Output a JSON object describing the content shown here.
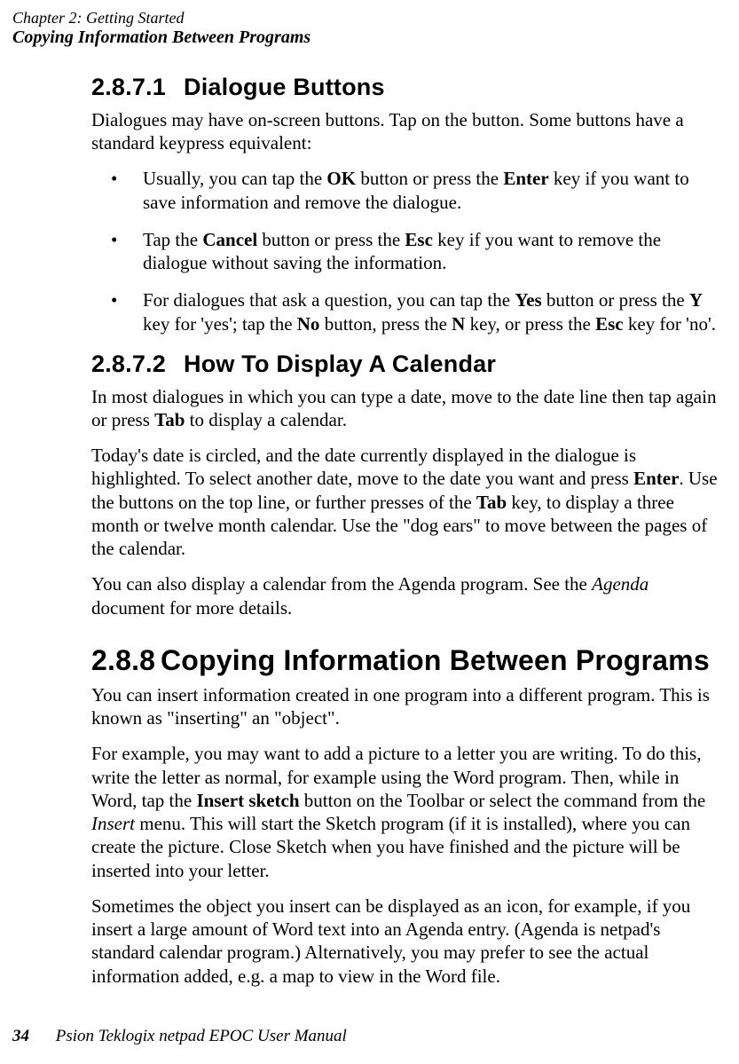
{
  "header": {
    "chapter": "Chapter 2:  Getting Started",
    "section": "Copying Information Between Programs"
  },
  "s1": {
    "num": "2.8.7.1",
    "title": "Dialogue Buttons",
    "intro_a": "Dialogues may have on-screen buttons. Tap on the button. Some buttons have a standard keypress equivalent:",
    "b1_a": "Usually, you can tap the ",
    "b1_ok": "OK",
    "b1_b": " button or press the ",
    "b1_enter": "Enter",
    "b1_c": " key if you want to save information and remove the dialogue.",
    "b2_a": "Tap the ",
    "b2_cancel": "Cancel",
    "b2_b": " button or press the ",
    "b2_esc": "Esc",
    "b2_c": " key if you want to remove the dialogue without saving the information.",
    "b3_a": "For dialogues that ask a question, you can tap the ",
    "b3_yes": "Yes",
    "b3_b": " button or press the ",
    "b3_Y": "Y",
    "b3_c": " key for 'yes'; tap the ",
    "b3_no": "No",
    "b3_d": " button, press the ",
    "b3_N": "N",
    "b3_e": " key, or press the ",
    "b3_esc": "Esc",
    "b3_f": " key for 'no'."
  },
  "s2": {
    "num": "2.8.7.2",
    "title": "How To Display A Calendar",
    "p1_a": "In most dialogues in which you can type a date, move to the date line then tap again or press ",
    "p1_tab": "Tab",
    "p1_b": " to display a calendar.",
    "p2_a": "Today's date is circled, and the date currently displayed in the dialogue is highlighted. To select another date, move to the date you want and press ",
    "p2_enter": "Enter",
    "p2_b": ". Use the buttons on the top line, or further presses of the ",
    "p2_tab": "Tab",
    "p2_c": " key, to display a three month or twelve month calendar. Use the \"dog ears\" to move between the pages of the calendar.",
    "p3_a": "You can also display a calendar from the Agenda program. See the ",
    "p3_agenda": "Agenda",
    "p3_b": " document for more details."
  },
  "s3": {
    "num": "2.8.8",
    "title": "Copying Information Between Programs",
    "p1": "You can insert information created in one program into a different program. This is known as \"inserting\" an \"object\".",
    "p2_a": "For example, you may want to add a picture to a letter you are writing. To do this, write the letter as normal, for example using the Word program. Then, while in Word, tap the ",
    "p2_insert_sketch": "Insert sketch",
    "p2_b": " button on the Toolbar or select the command from the ",
    "p2_insert": "Insert",
    "p2_c": " menu. This will start the Sketch program (if it is installed), where you can create the picture. Close Sketch when you have finished and the picture will be inserted into your letter.",
    "p3": "Sometimes the object you insert can be displayed as an icon, for example, if you insert a large amount of Word text into an Agenda entry. (Agenda is netpad's standard calendar program.) Alternatively, you may prefer to see the actual information added, e.g. a map to view in the Word file."
  },
  "footer": {
    "page": "34",
    "title": "Psion Teklogix netpad EPOC User Manual"
  }
}
